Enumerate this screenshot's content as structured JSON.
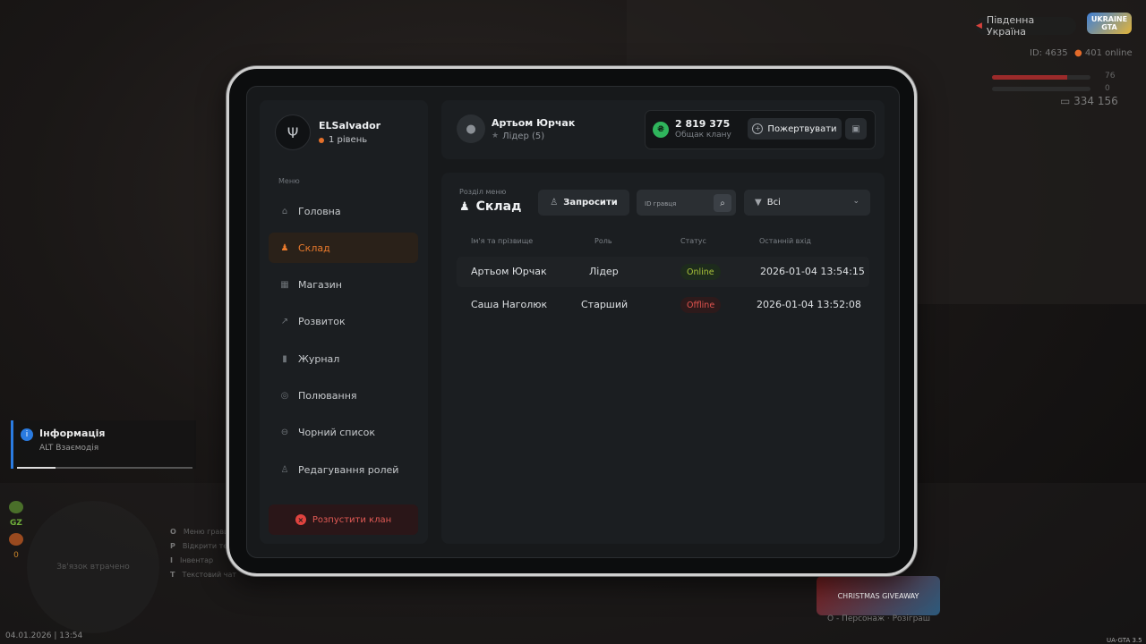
{
  "hud": {
    "region": "Південна Україна",
    "logo_text": "UKRAINE GTA",
    "player_id": "ID: 4635",
    "online": "401 online",
    "health_value": "76",
    "health_fraction": 0.76,
    "armor_value": "0",
    "armor_fraction": 0.0,
    "money": "334 156",
    "info_card": {
      "title": "Інформація",
      "subtitle": "ALT Взаємодія",
      "progress": 0.22
    },
    "side_badges": [
      "GZ",
      "0"
    ],
    "minimap_text": "Зв'язок втрачено",
    "hints": [
      {
        "key": "O",
        "label": "Меню гравця"
      },
      {
        "key": "P",
        "label": "Відкрити телефон"
      },
      {
        "key": "I",
        "label": "Інвентар"
      },
      {
        "key": "T",
        "label": "Текстовий чат"
      }
    ],
    "datetime": "04.01.2026 | 13:54",
    "promo_text": "CHRISTMAS GIVEAWAY",
    "promo_caption": "O - Персонаж · Розіграш",
    "version": "UA-GTA 3.5"
  },
  "org": {
    "name": "ELSalvador",
    "level": "1 рівень"
  },
  "menu_label": "Меню",
  "nav": [
    {
      "icon": "home-icon",
      "glyph": "⌂",
      "label": "Головна",
      "active": false
    },
    {
      "icon": "people-icon",
      "glyph": "♟",
      "label": "Склад",
      "active": true
    },
    {
      "icon": "shop-icon",
      "glyph": "▦",
      "label": "Магазин",
      "active": false
    },
    {
      "icon": "chart-icon",
      "glyph": "↗",
      "label": "Розвиток",
      "active": false
    },
    {
      "icon": "journal-icon",
      "glyph": "▮",
      "label": "Журнал",
      "active": false
    },
    {
      "icon": "target-icon",
      "glyph": "◎",
      "label": "Полювання",
      "active": false
    },
    {
      "icon": "block-icon",
      "glyph": "⊖",
      "label": "Чорний список",
      "active": false
    },
    {
      "icon": "user-edit-icon",
      "glyph": "♙",
      "label": "Редагування ролей",
      "active": false
    }
  ],
  "dissolve_label": "Розпустити клан",
  "profile": {
    "name": "Артьом Юрчак",
    "role": "Лідер (5)"
  },
  "balance": {
    "amount": "2 819 375",
    "label": "Общак клану",
    "donate_label": "Пожертвувати"
  },
  "section": {
    "label": "Розділ меню",
    "title": "Склад",
    "invite_label": "Запросити",
    "search_placeholder": "ID гравця",
    "filter_value": "Всі"
  },
  "table": {
    "headers": [
      "Ім'я та прізвище",
      "Роль",
      "Статус",
      "Останній вхід"
    ],
    "rows": [
      {
        "name": "Артьом Юрчак",
        "role": "Лідер",
        "status": "Online",
        "last": "2026-01-04 13:54:15"
      },
      {
        "name": "Саша Наголюк",
        "role": "Старший",
        "status": "Offline",
        "last": "2026-01-04 13:52:08"
      }
    ]
  },
  "colors": {
    "accent": "#ea7a2c",
    "online": "#a9c23a",
    "offline": "#e2544f",
    "coin": "#2fb55c"
  }
}
